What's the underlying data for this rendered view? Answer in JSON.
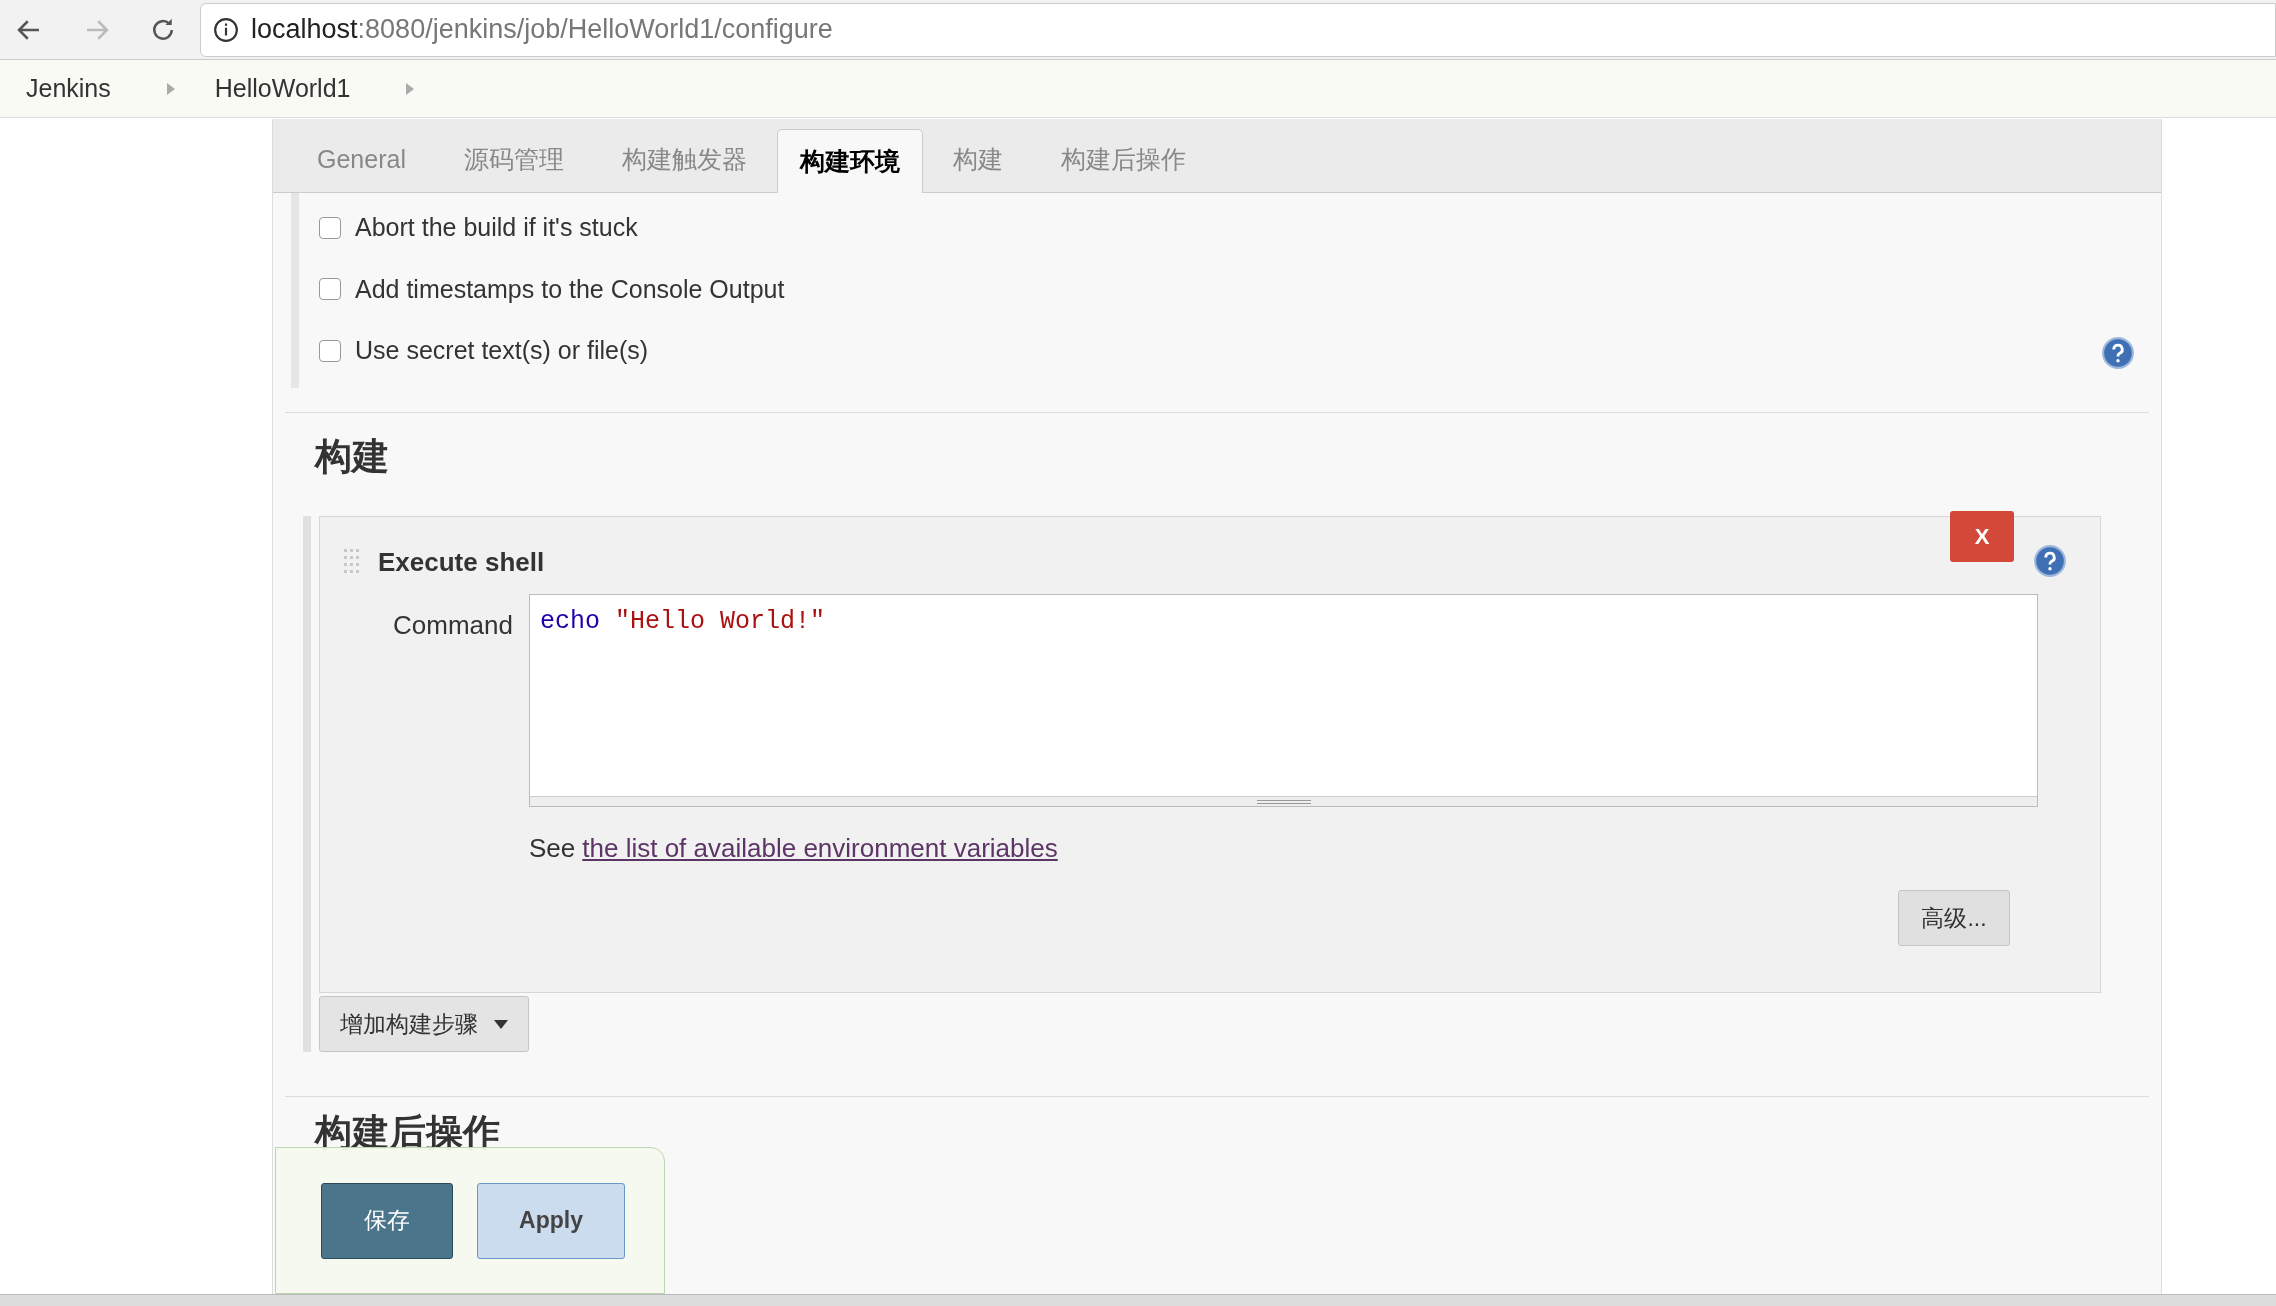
{
  "browser": {
    "url_host": "localhost",
    "url_path": ":8080/jenkins/job/HelloWorld1/configure"
  },
  "breadcrumbs": [
    "Jenkins",
    "HelloWorld1"
  ],
  "tabs": [
    {
      "label": "General",
      "selected": false
    },
    {
      "label": "源码管理",
      "selected": false
    },
    {
      "label": "构建触发器",
      "selected": false
    },
    {
      "label": "构建环境",
      "selected": true
    },
    {
      "label": "构建",
      "selected": false
    },
    {
      "label": "构建后操作",
      "selected": false
    }
  ],
  "build_environment": [
    {
      "label": "Abort the build if it's stuck",
      "checked": false
    },
    {
      "label": "Add timestamps to the Console Output",
      "checked": false
    },
    {
      "label": "Use secret text(s) or file(s)",
      "checked": false
    }
  ],
  "build": {
    "heading": "构建",
    "step": {
      "title": "Execute shell",
      "delete": "X",
      "command_label": "Command",
      "command_keyword": "echo",
      "command_string": "\"Hello World!\"",
      "hint": "See",
      "hint_link": "the list of available environment variables",
      "advanced": "高级..."
    },
    "add_step": "增加构建步骤"
  },
  "post_build": {
    "heading": "构建后操作"
  },
  "actions": {
    "save": "保存",
    "apply": "Apply"
  }
}
